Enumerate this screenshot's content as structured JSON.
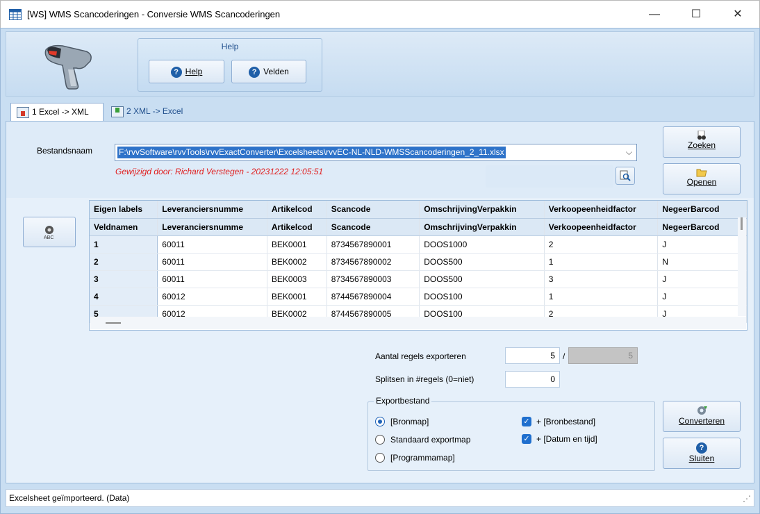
{
  "window": {
    "title": "[WS]  WMS Scancoderingen - Conversie WMS Scancoderingen",
    "minimize": "—",
    "maximize": "☐",
    "close": "✕"
  },
  "help_group": {
    "title": "Help",
    "help_label": "Help",
    "fields_label": "Velden"
  },
  "tabs": [
    {
      "label": "1 Excel -> XML",
      "active": true
    },
    {
      "label": "2 XML -> Excel",
      "active": false
    }
  ],
  "file": {
    "label": "Bestandsnaam",
    "path": "F:\\rvvSoftware\\rvvTools\\rvvExactConverter\\Excelsheets\\rvvEC-NL-NLD-WMSScancoderingen_2_11.xlsx",
    "modified": "Gewijzigd door: Richard Verstegen   -   20231222  12:05:51"
  },
  "buttons": {
    "search": "Zoeken",
    "open": "Openen",
    "convert": "Converteren",
    "close": "Sluiten"
  },
  "grid": {
    "header_rows": [
      [
        "Eigen labels",
        "Leveranciersnumme",
        "Artikelcod",
        "Scancode",
        "OmschrijvingVerpakkin",
        "Verkoopeenheidfactor",
        "NegeerBarcod"
      ],
      [
        "Veldnamen",
        "Leveranciersnumme",
        "Artikelcod",
        "Scancode",
        "OmschrijvingVerpakkin",
        "Verkoopeenheidfactor",
        "NegeerBarcod"
      ]
    ],
    "rows": [
      [
        "1",
        "60011",
        "BEK0001",
        "8734567890001",
        "DOOS1000",
        "2",
        "J"
      ],
      [
        "2",
        "60011",
        "BEK0002",
        "8734567890002",
        "DOOS500",
        "1",
        "N"
      ],
      [
        "3",
        "60011",
        "BEK0003",
        "8734567890003",
        "DOOS500",
        "3",
        "J"
      ],
      [
        "4",
        "60012",
        "BEK0001",
        "8744567890004",
        "DOOS100",
        "1",
        "J"
      ],
      [
        "5",
        "60012",
        "BEK0002",
        "8744567890005",
        "DOOS100",
        "2",
        "J"
      ]
    ]
  },
  "export": {
    "rows_label": "Aantal regels exporteren",
    "rows_value": "5",
    "separator": "/",
    "rows_total": "5",
    "split_label": "Splitsen in #regels (0=niet)",
    "split_value": "0",
    "group_label": "Exportbestand",
    "options": [
      "[Bronmap]",
      "Standaard exportmap",
      "[Programmamap]"
    ],
    "selected_option": "[Bronmap]",
    "checkboxes": [
      "+ [Bronbestand]",
      "+ [Datum en tijd]"
    ]
  },
  "status": {
    "text": "Excelsheet geïmporteerd. (Data)"
  }
}
